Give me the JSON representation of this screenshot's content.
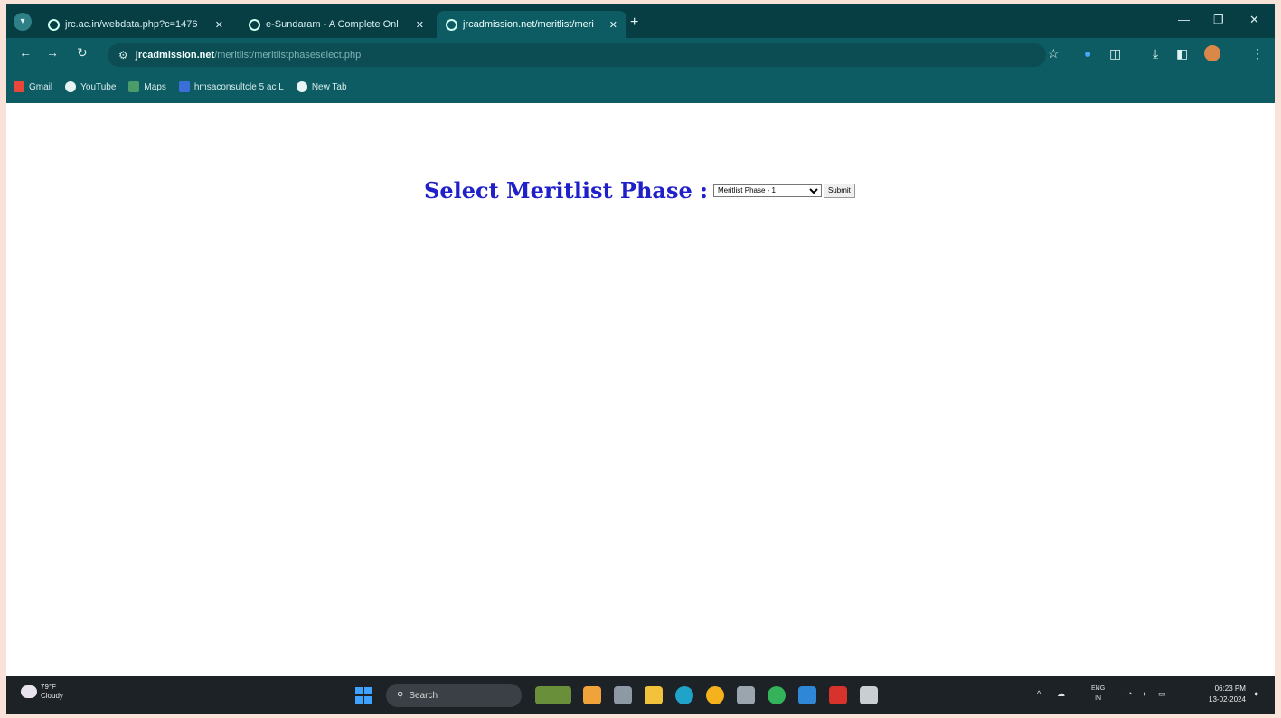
{
  "browser": {
    "tabs": [
      {
        "title": "jrc.ac.in/webdata.php?c=1476",
        "active": false
      },
      {
        "title": "e-Sundaram - A Complete Onl",
        "active": false
      },
      {
        "title": "jrcadmission.net/meritlist/meri",
        "active": true
      }
    ],
    "url_host": "jrcadmission.net",
    "url_path": "/meritlist/meritlistphaseselect.php",
    "bookmarks": [
      "Gmail",
      "YouTube",
      "Maps",
      "hmsaconsultcle 5 ac L",
      "New Tab"
    ],
    "colors": {
      "frame": "#063e44",
      "toolbar": "#0e5c63"
    }
  },
  "page": {
    "label": "Select Meritlist Phase :",
    "select": {
      "options": [
        "Meritlist Phase - 1"
      ],
      "selected": "Meritlist Phase - 1"
    },
    "submit_label": "Submit",
    "label_color": "#2020c8"
  },
  "taskbar": {
    "weather_temp": "79°F",
    "weather_desc": "Cloudy",
    "search_placeholder": "Search",
    "lang_top": "ENG",
    "lang_bottom": "IN",
    "time": "06:23 PM",
    "date": "13-02-2024"
  }
}
